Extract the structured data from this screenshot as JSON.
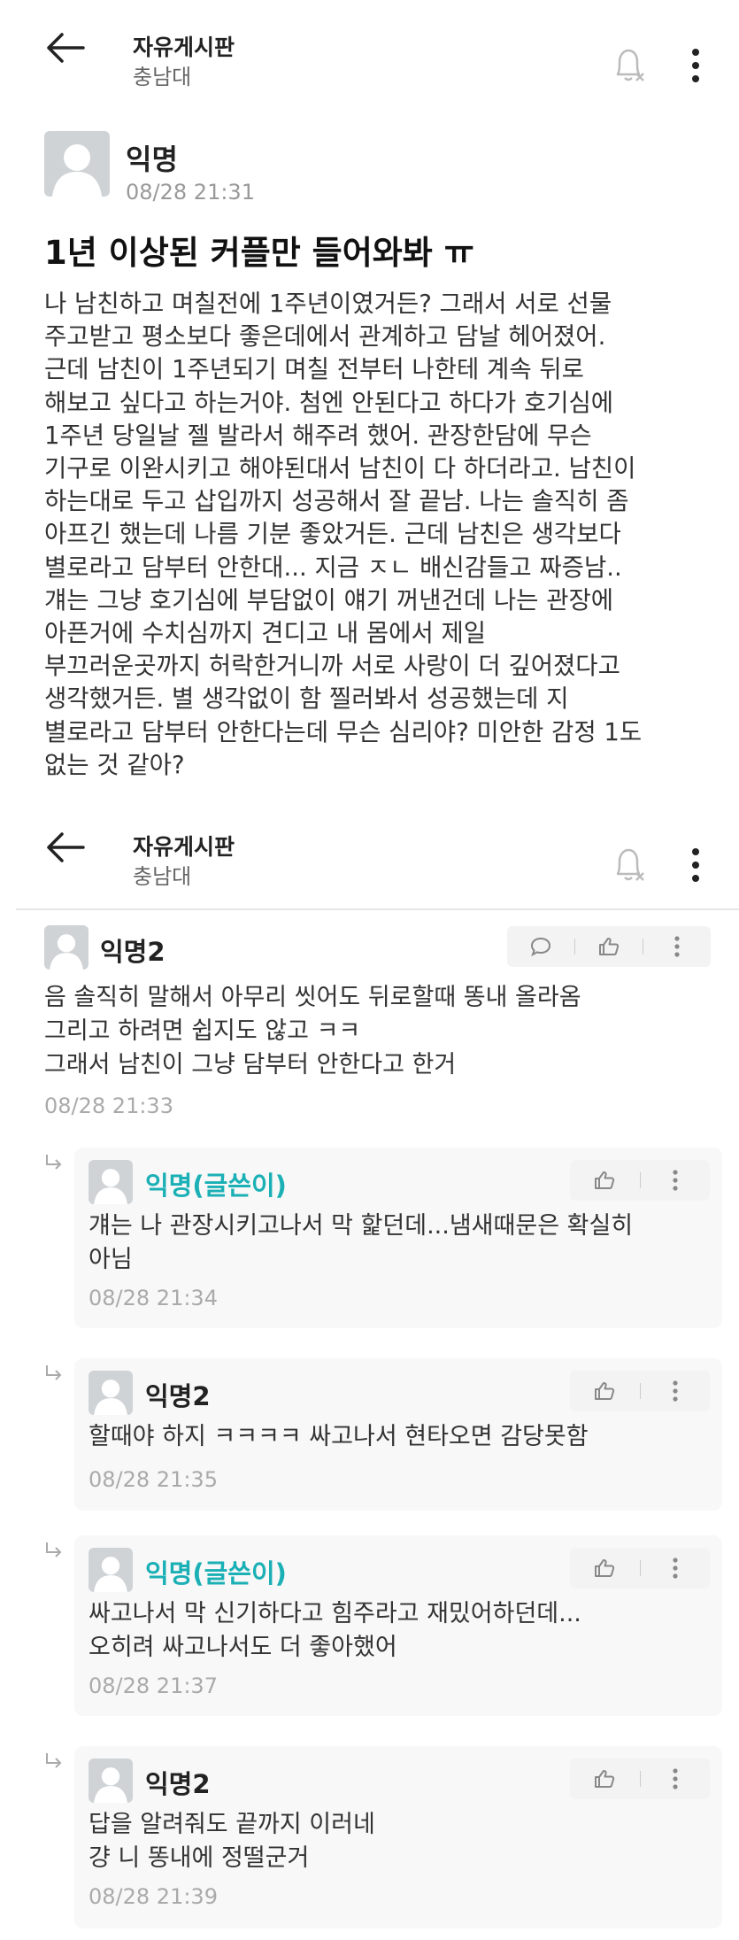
{
  "header": {
    "title": "자유게시판",
    "subtitle": "충남대"
  },
  "post": {
    "author": "익명",
    "date": "08/28 21:31",
    "title": "1년 이상된 커플만 들어와봐 ㅠ",
    "body": "나 남친하고 며칠전에 1주년이였거든? 그래서 서로 선물\n주고받고 평소보다 좋은데에서 관계하고 담날 헤어졌어.\n근데 남친이 1주년되기 며칠 전부터 나한테 계속 뒤로\n해보고 싶다고 하는거야. 첨엔 안된다고 하다가 호기심에\n1주년 당일날 젤 발라서 해주려 했어. 관장한담에 무슨\n기구로 이완시키고 해야된대서 남친이 다 하더라고. 남친이\n하는대로 두고 삽입까지 성공해서 잘 끝남. 나는 솔직히 좀\n아프긴 했는데 나름 기분 좋았거든. 근데 남친은 생각보다\n별로라고 담부터 안한대... 지금 ㅈㄴ 배신감들고 짜증남..\n걔는 그냥 호기심에 부담없이 얘기 꺼낸건데 나는 관장에\n아픈거에 수치심까지 견디고 내 몸에서 제일\n부끄러운곳까지 허락한거니까 서로 사랑이 더 깊어졌다고\n생각했거든. 별 생각없이 함 찔러봐서 성공했는데 지\n별로라고 담부터 안한다는데 무슨 심리야? 미안한 감정 1도\n없는 것 같아?"
  },
  "comment": {
    "author": "익명2",
    "text": "음 솔직히 말해서 아무리 씻어도 뒤로할때 똥내 올라옴\n그리고 하려면 쉽지도 않고 ㅋㅋ\n그래서 남친이 그냥 담부터 안한다고 한거",
    "date": "08/28 21:33"
  },
  "replies": [
    {
      "author": "익명(글쓴이)",
      "is_op": true,
      "text": "걔는 나 관장시키고나서 막 핥던데...냄새때문은 확실히\n아님",
      "date": "08/28 21:34"
    },
    {
      "author": "익명2",
      "is_op": false,
      "text": "할때야 하지 ㅋㅋㅋㅋ 싸고나서 현타오면 감당못함",
      "date": "08/28 21:35"
    },
    {
      "author": "익명(글쓴이)",
      "is_op": true,
      "text": "싸고나서 막 신기하다고 힘주라고 재밌어하던데...\n오히려 싸고나서도 더 좋아했어",
      "date": "08/28 21:37"
    },
    {
      "author": "익명2",
      "is_op": false,
      "text": "답을 알려줘도 끝까지 이러네\n걍 니 똥내에 정떨군거",
      "date": "08/28 21:39"
    }
  ],
  "icons": {
    "back": "back-arrow-icon",
    "bell": "notification-off-icon",
    "more": "more-vertical-icon",
    "reply_comment": "comment-icon",
    "like": "thumbs-up-icon",
    "reply_arrow": "reply-arrow-icon"
  },
  "colors": {
    "op_author": "#1ab0b5",
    "date": "#999999",
    "avatar": "#cfd3d6"
  }
}
